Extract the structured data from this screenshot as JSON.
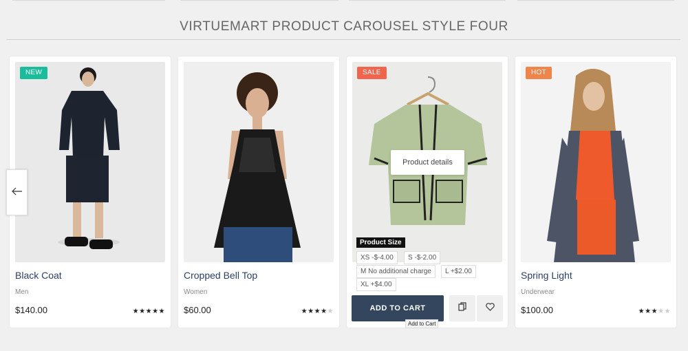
{
  "section": {
    "title": "VIRTUEMART PRODUCT CAROUSEL STYLE FOUR"
  },
  "colors": {
    "new": "#1bbc9b",
    "sale": "#f0654c",
    "hot": "#f0854c",
    "cart": "#34465e"
  },
  "products": [
    {
      "badge": "NEW",
      "name": "Black Coat",
      "category": "Men",
      "price": "$140.00",
      "rating": 5,
      "stars": "★★★★★",
      "stars_off": ""
    },
    {
      "badge": "",
      "name": "Cropped Bell Top",
      "category": "Women",
      "price": "$60.00",
      "rating": 4,
      "stars": "★★★★",
      "stars_off": "★"
    },
    {
      "badge": "SALE",
      "details_label": "Product details"
    },
    {
      "badge": "HOT",
      "name": "Spring Light",
      "category": "Underwear",
      "price": "$100.00",
      "rating": 3,
      "stars": "★★★",
      "stars_off": "★★"
    }
  ],
  "size_selector": {
    "label": "Product Size",
    "options": [
      "XS -$-4.00",
      "S -$-2.00",
      "M No additional charge",
      "L +$2.00",
      "XL +$4.00"
    ]
  },
  "actions": {
    "add_to_cart": "ADD TO CART",
    "tooltip": "Add to Cart"
  },
  "icons": {
    "prev": "arrow-left-icon",
    "compare": "copy-icon",
    "wishlist": "heart-icon"
  }
}
